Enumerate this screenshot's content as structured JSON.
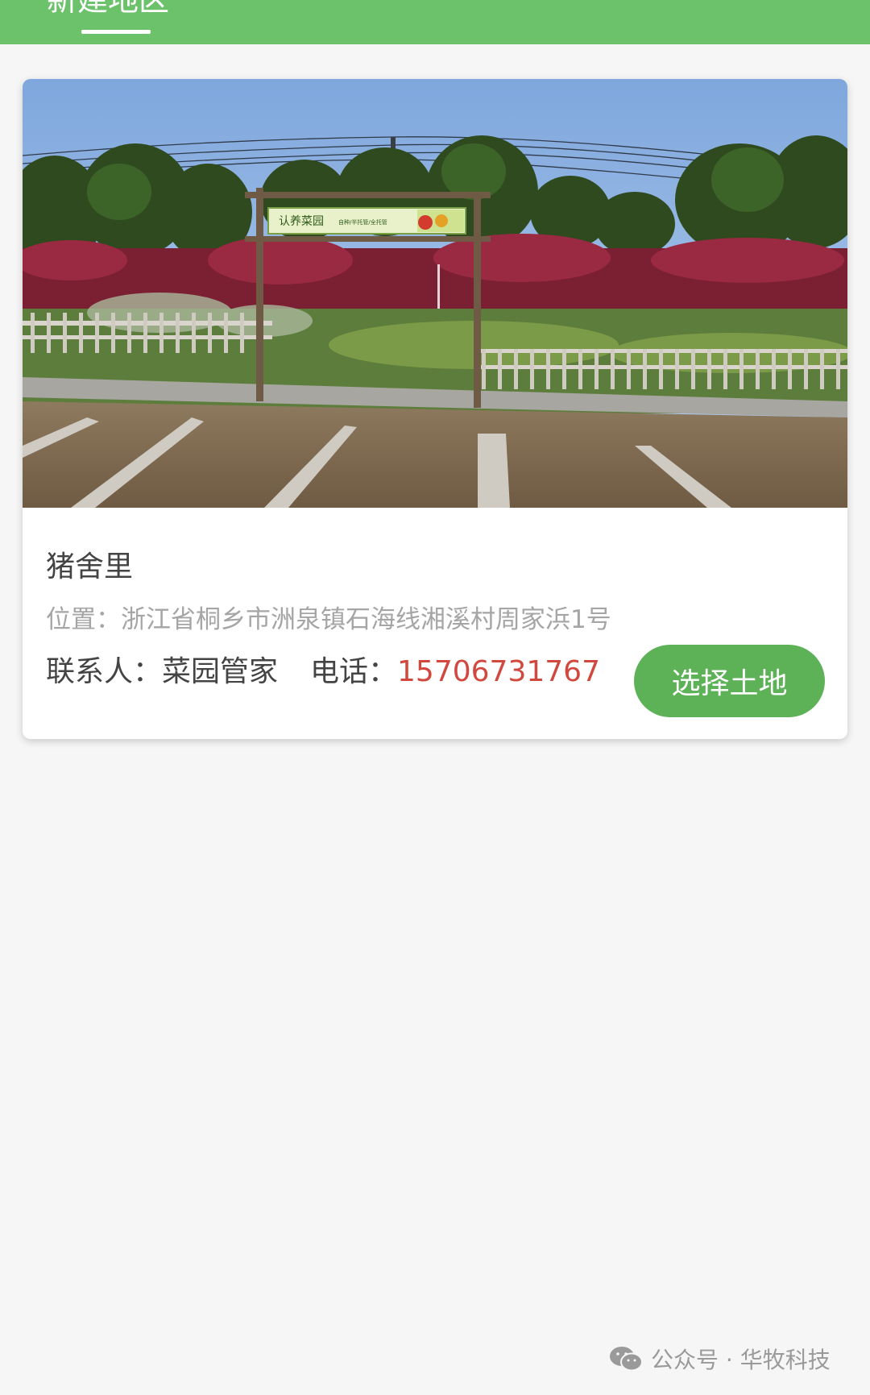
{
  "header": {
    "tab_label": "新建地区",
    "bg_color": "#6cc26a"
  },
  "garden": {
    "photo_sign_title": "认养菜园",
    "photo_sign_subtitle": "自种/半托管/全托管",
    "name": "猪舍里",
    "address": "位置：浙江省桐乡市洲泉镇石海线湘溪村周家浜1号",
    "contact_label": "联系人：菜园管家",
    "phone_label": "电话：",
    "phone": "15706731767",
    "select_button": "选择土地",
    "button_color": "#5db157",
    "phone_color": "#d0483e"
  },
  "watermark": {
    "icon": "wechat-icon",
    "text": "公众号 · 华牧科技"
  }
}
